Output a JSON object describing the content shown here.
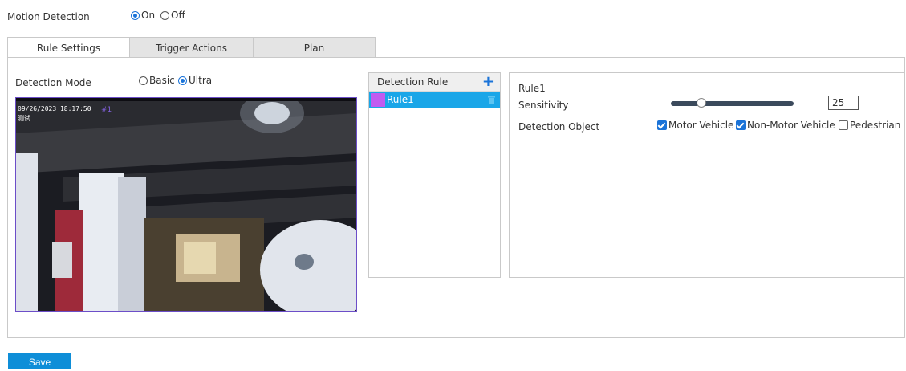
{
  "motion": {
    "label": "Motion Detection",
    "on_label": "On",
    "off_label": "Off",
    "selected": "On"
  },
  "tabs": [
    {
      "label": "Rule Settings",
      "active": true
    },
    {
      "label": "Trigger Actions",
      "active": false
    },
    {
      "label": "Plan",
      "active": false
    }
  ],
  "detection_mode": {
    "label": "Detection Mode",
    "basic_label": "Basic",
    "ultra_label": "Ultra",
    "selected": "Ultra"
  },
  "video": {
    "timestamp": "09/26/2023 18:17:50",
    "channel_text": "测试",
    "rule_marker": "#1"
  },
  "rule_list": {
    "header": "Detection Rule",
    "add_icon": "plus-icon",
    "items": [
      {
        "name": "Rule1",
        "color": "#c15bf0",
        "selected": true,
        "delete_icon": "trash-icon"
      }
    ]
  },
  "rule_detail": {
    "title": "Rule1",
    "sensitivity_label": "Sensitivity",
    "sensitivity_value": "25",
    "sensitivity_fraction": 0.25,
    "detection_object_label": "Detection Object",
    "objects": [
      {
        "label": "Motor Vehicle",
        "checked": true
      },
      {
        "label": "Non-Motor Vehicle",
        "checked": true
      },
      {
        "label": "Pedestrian",
        "checked": false
      }
    ]
  },
  "save_label": "Save",
  "colors": {
    "accent": "#1a73d8",
    "selected_row": "#1aa6e8",
    "save_button": "#0e8ed8",
    "rule_color": "#c15bf0"
  }
}
